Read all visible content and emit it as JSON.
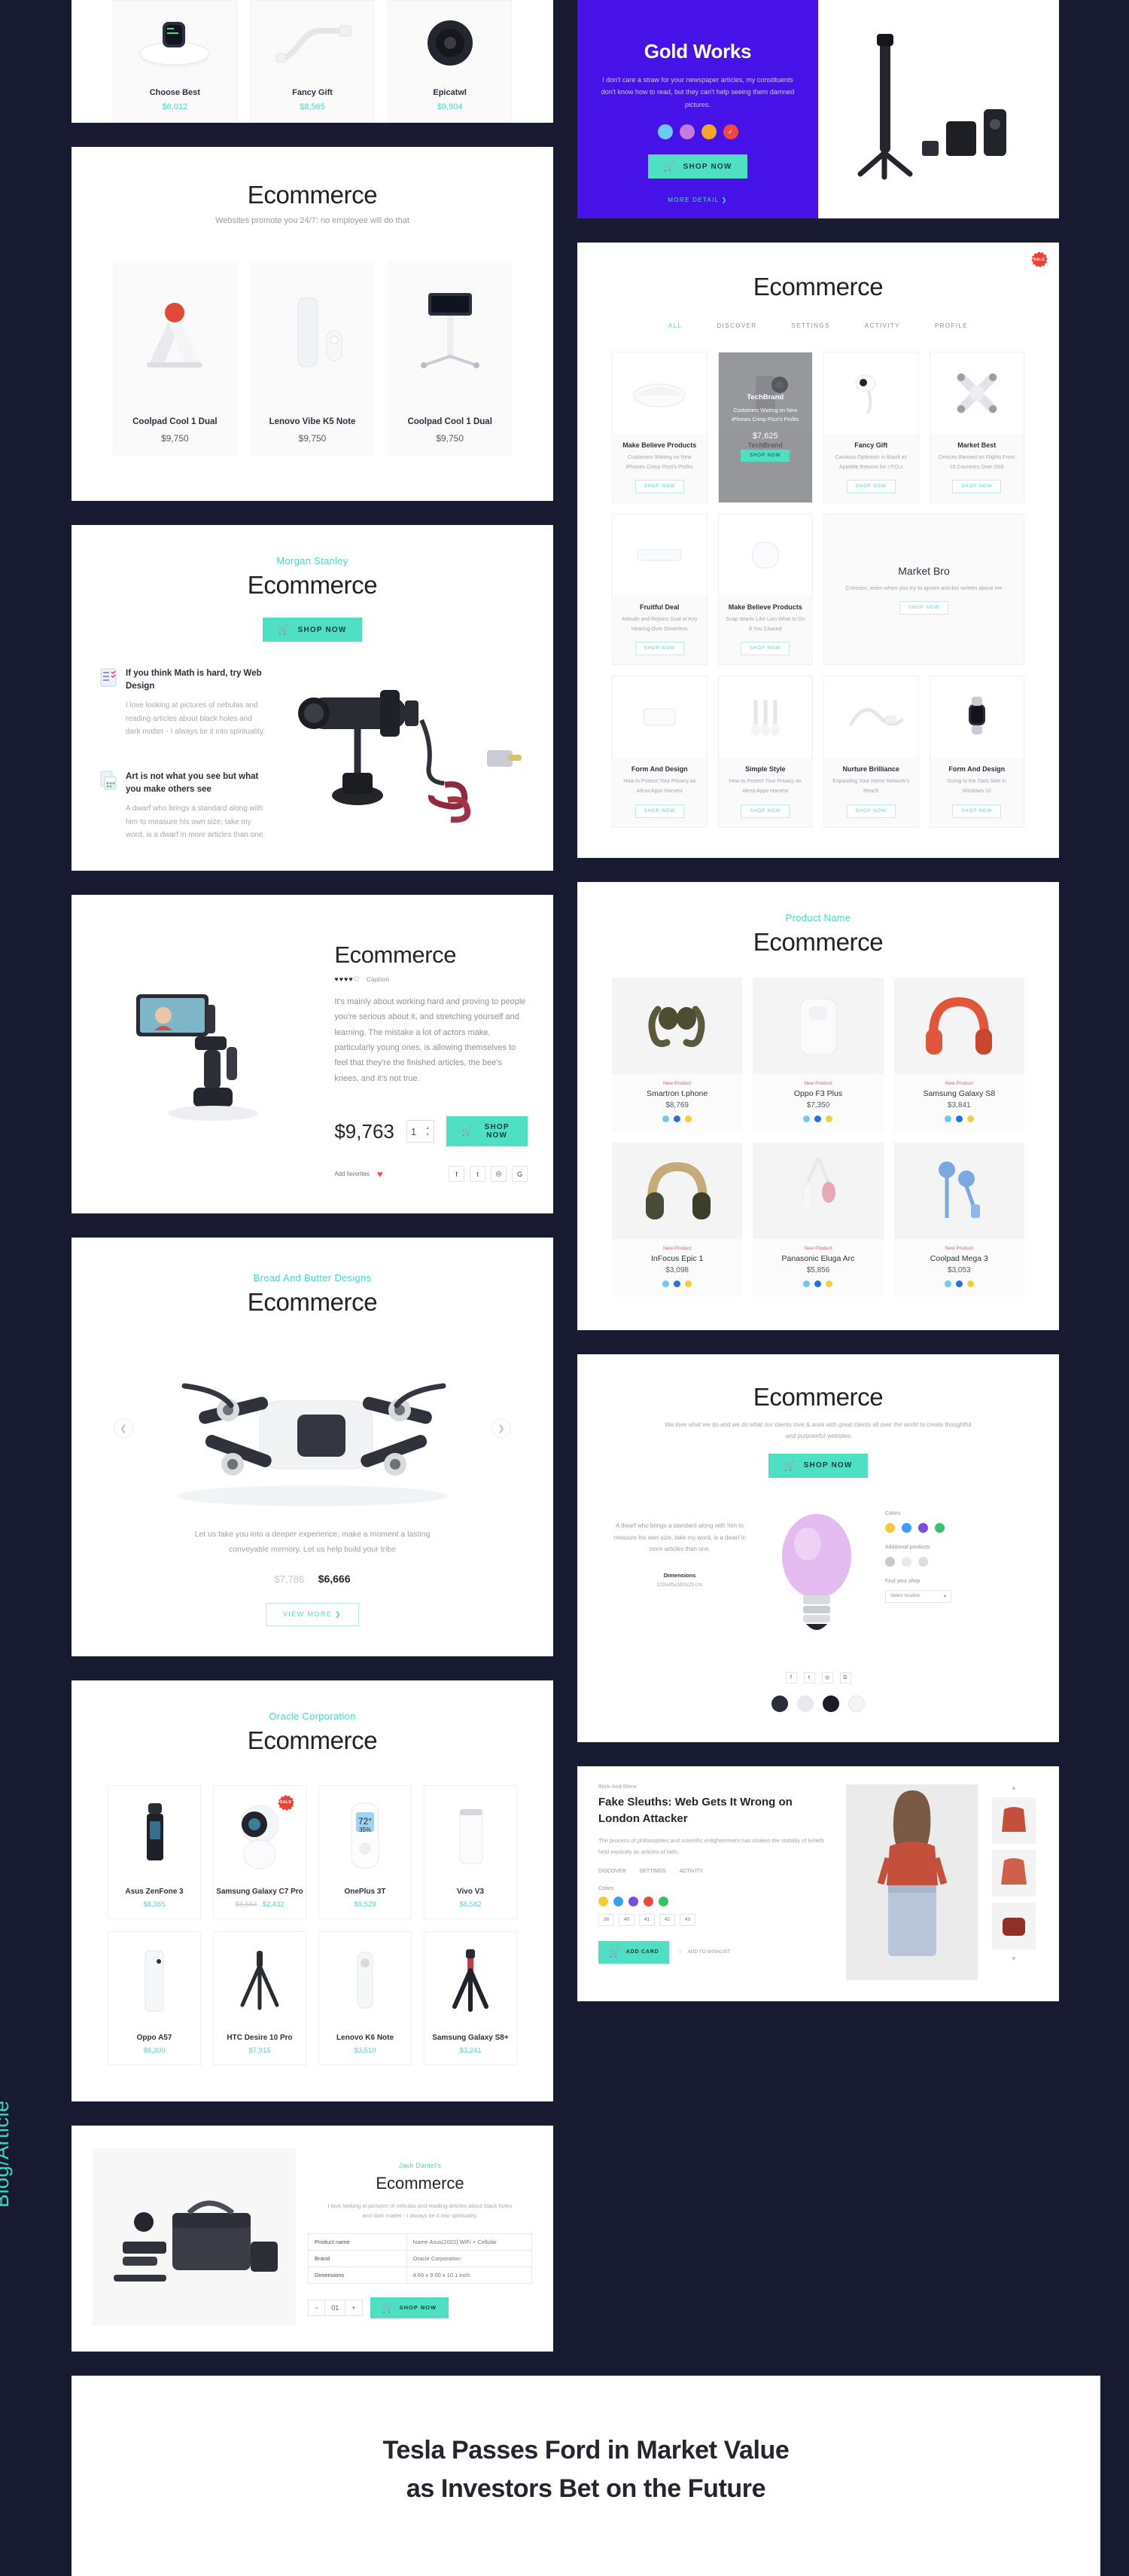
{
  "side_label": "Blog/Article",
  "brand_colors": {
    "accent": "#4fd8c2",
    "bg": "#171a31",
    "purple": "#4612e8",
    "sale": "#ef4136"
  },
  "top_strip": {
    "products": [
      {
        "name": "Choose Best",
        "price": "$6,012"
      },
      {
        "name": "Fancy Gift",
        "price": "$8,565"
      },
      {
        "name": "Epicatwl",
        "price": "$9,904"
      }
    ]
  },
  "ecom_three": {
    "title": "Ecommerce",
    "subtitle": "Websites promote you 24/7: no employee will do that",
    "products": [
      {
        "name": "Coolpad Cool 1 Dual",
        "price": "$9,750"
      },
      {
        "name": "Lenovo Vibe K5 Note",
        "price": "$9,750"
      },
      {
        "name": "Coolpad Cool 1 Dual",
        "price": "$9,750"
      }
    ]
  },
  "feature": {
    "eyebrow": "Morgan Stanley",
    "title": "Ecommerce",
    "shop_label": "SHOP NOW",
    "items": [
      {
        "title": "If you think Math is hard, try Web Design",
        "text": "I love looking at pictures of nebulas and reading articles about black holes and dark matter - I always tie it into spirituality."
      },
      {
        "title": "Art is not what you see but what you make others see",
        "text": "A dwarf who brings a standard along with him to measure his own size, take my word, is a dwarf in more articles than one."
      }
    ]
  },
  "detail": {
    "title": "Ecommerce",
    "hearts": "♥♥♥♥♡",
    "caption": "Caption",
    "description": "It's mainly about working hard and proving to people you're serious about it, and stretching yourself and learning. The mistake a lot of actors make, particularly young ones, is allowing themselves to feel that they're the finished articles, the bee's knees, and it's not true.",
    "price": "$9,763",
    "qty": "1",
    "shop_label": "SHOP NOW",
    "fav_label": "Add favorites",
    "socials": [
      "f",
      "t",
      "◎",
      "G"
    ]
  },
  "drone": {
    "eyebrow": "Bread And Butter Designs",
    "title": "Ecommerce",
    "blurb": "Let us take you into a deeper experience, make a moment a lasting conveyable memory. Let us help build your tribe",
    "old_price": "$7,786",
    "new_price": "$6,666",
    "view_more": "VIEW MORE  ❯",
    "prev": "❮",
    "next": "❯"
  },
  "oracle": {
    "eyebrow": "Oracle Corporation",
    "title": "Ecommerce",
    "products": [
      {
        "name": "Asus ZenFone 3",
        "price": "$8,365",
        "old": "",
        "sale": false
      },
      {
        "name": "Samsung Galaxy C7 Pro",
        "price": "$2,432",
        "old": "$8,564",
        "sale": true
      },
      {
        "name": "OnePlus 3T",
        "price": "$9,529",
        "old": "",
        "sale": false
      },
      {
        "name": "Vivo V3",
        "price": "$8,582",
        "old": "",
        "sale": false
      },
      {
        "name": "Oppo A57",
        "price": "$8,300",
        "old": "",
        "sale": false
      },
      {
        "name": "HTC Desire 10 Pro",
        "price": "$7,915",
        "old": "",
        "sale": false
      },
      {
        "name": "Lenovo K6 Note",
        "price": "$3,510",
        "old": "",
        "sale": false
      },
      {
        "name": "Samsung Galaxy S8+",
        "price": "$3,241",
        "old": "",
        "sale": false
      }
    ],
    "sale_badge": "SALE"
  },
  "bag": {
    "eyebrow": "Jack Daniel's",
    "title": "Ecommerce",
    "note": "I love looking at pictures of nebulas and reading articles about black holes and dark matter - I always tie it into spirituality.",
    "specs": [
      {
        "k": "Product name",
        "v": "Name Asus(2022) WiFi + Cellular"
      },
      {
        "k": "Brand",
        "v": "Oracle Corporation"
      },
      {
        "k": "Dimensions",
        "v": "4.65 x 9.00 x 10.1 inch"
      }
    ],
    "qty_minus": "−",
    "qty_value": "01",
    "qty_plus": "+",
    "shop_label": "SHOP NOW"
  },
  "hero": {
    "title": "Gold Works",
    "text": "I don't care a straw for your newspaper articles, my constituents don't know how to read, but they can't help seeing them damned pictures.",
    "dots": [
      "#6ec9f5",
      "#c77ae0",
      "#f5a623",
      "#f0483c"
    ],
    "shop_label": "SHOP NOW",
    "more_label": "MORE DETAIL  ❯"
  },
  "shop": {
    "title": "Ecommerce",
    "tabs": [
      {
        "label": "ALL",
        "active": true
      },
      {
        "label": "DISCOVER",
        "active": false
      },
      {
        "label": "SETTINGS",
        "active": false
      },
      {
        "label": "ACTIVITY",
        "active": false
      },
      {
        "label": "PROFILE",
        "active": false
      }
    ],
    "shop_label": "SHOP NOW",
    "products": [
      {
        "name": "Make Believe Products",
        "desc": "Customers Waiting on New iPhones Crimp Pizzi's Profits",
        "price": "",
        "sale": false,
        "overlay": false
      },
      {
        "name": "TechBrand",
        "desc": "Customers Waiting on New iPhones Crimp Pizzi's Profits",
        "price": "$7,625",
        "sale": false,
        "overlay": true
      },
      {
        "name": "Fancy Gift",
        "desc": "Cautious Optimism in Brazil as Appetite Returns for I.P.O.s",
        "price": "",
        "sale": true,
        "overlay": false
      },
      {
        "name": "Market Best",
        "desc": "Devices Banned on Flights From 10 Countries Over ISIS",
        "price": "",
        "sale": false,
        "overlay": false
      },
      {
        "name": "Fruitful Deal",
        "desc": "Attitude and Rejoins Dual at Key Hearing Over Driverless",
        "price": "",
        "sale": false,
        "overlay": false
      },
      {
        "name": "Make Believe Products",
        "desc": "Snap Wants Like Lion What to Do If You Chased",
        "price": "",
        "sale": false,
        "overlay": false
      },
      {
        "name": "Form And Design",
        "desc": "How to Protect Your Privacy as Alexa Apps Harvest",
        "price": "",
        "sale": false,
        "overlay": false
      },
      {
        "name": "Simple Style",
        "desc": "How to Protect Your Privacy as Alexa Apps Harvest",
        "price": "",
        "sale": false,
        "overlay": false
      },
      {
        "name": "Nurture Brilliance",
        "desc": "Expanding Your Home Network's Reach",
        "price": "",
        "sale": false,
        "overlay": false
      },
      {
        "name": "Form And Design",
        "desc": "Going to the Dark Side in Windows 10",
        "price": "",
        "sale": false,
        "overlay": false
      }
    ],
    "wide": {
      "name": "Market Bro",
      "desc": "Criticism, even when you try to ignore articles written about me",
      "btn": "SHOP NOW"
    }
  },
  "newprod": {
    "eyebrow": "Product Name",
    "title": "Ecommerce",
    "tag": "New Product",
    "products": [
      {
        "name": "Smartron t.phone",
        "price": "$8,769",
        "swatches": [
          "#6ec9f5",
          "#2a6fe0",
          "#f5cf3a"
        ]
      },
      {
        "name": "Oppo F3 Plus",
        "price": "$7,350",
        "swatches": [
          "#6ec9f5",
          "#2a6fe0",
          "#f5cf3a"
        ]
      },
      {
        "name": "Samsung Galaxy S8",
        "price": "$3,841",
        "swatches": [
          "#6ec9f5",
          "#2a6fe0",
          "#f5cf3a"
        ]
      },
      {
        "name": "InFocus Epic 1",
        "price": "$3,098",
        "swatches": [
          "#6ec9f5",
          "#2a6fe0",
          "#f5cf3a"
        ]
      },
      {
        "name": "Panasonic Eluga Arc",
        "price": "$5,856",
        "swatches": [
          "#6ec9f5",
          "#2a6fe0",
          "#f5cf3a"
        ]
      },
      {
        "name": "Coolpad Mega 3",
        "price": "$3,053",
        "swatches": [
          "#6ec9f5",
          "#2a6fe0",
          "#f5cf3a"
        ]
      }
    ]
  },
  "bulbcard": {
    "title": "Ecommerce",
    "lede": "We love what we do and we do what our clients love & work with great clients all over the world to create thoughtful and purposeful websites",
    "shop_label": "SHOP NOW",
    "left_text": "A dwarf who brings a standard along with him to measure his own size, take my word, is a dwarf in more articles than one.",
    "dim_title": "Dimensions",
    "dim_value": "120x45x160x25 cm",
    "colors_label": "Colors",
    "colors": [
      "#f5c93a",
      "#3aa0f5",
      "#7a4ce0",
      "#35c46b"
    ],
    "addl_label": "Additional products",
    "addl_colors": [
      "#c8c9cf",
      "#e8e9ee",
      "#dcdde3"
    ],
    "shop_label2": "Find your shop",
    "select_value": "Select location",
    "footer_icons": [
      "f",
      "t",
      "◎",
      "G"
    ],
    "thumbs": [
      "#2b2d3c",
      "#e8e9ee",
      "#1b1d2b"
    ]
  },
  "article": {
    "kicker": "Brick-And-Stone",
    "headline": "Fake Sleuths: Web Gets It Wrong on London Attacker",
    "paragraph": "The process of philosophies and scientific enlightenment has shaken the stability of beliefs held explicitly as articles of faith.",
    "tabs": [
      "DISCOVER",
      "SETTINGS",
      "ACTIVITY"
    ],
    "colors_label": "Colors",
    "colors": [
      "#f5c93a",
      "#3aa0f5",
      "#7a4ce0",
      "#f0483c",
      "#35c46b"
    ],
    "sizes": [
      "38",
      "40",
      "41",
      "42",
      "43"
    ],
    "add_cart": "ADD CARD",
    "wishlist": "ADD TO WISHLIST"
  },
  "band": {
    "line1": "Tesla Passes Ford in Market Value",
    "line2": "as Investors Bet on the Future"
  }
}
